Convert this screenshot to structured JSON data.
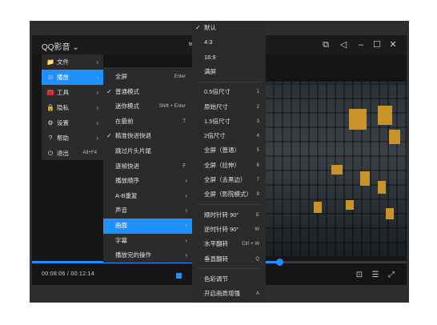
{
  "app": {
    "title": "QQ影音",
    "title_arrow": "⌄",
    "tab_fragment": "te"
  },
  "titlebar_icons": [
    "screenshot-icon",
    "share-icon",
    "minimize-icon",
    "maximize-icon",
    "close-icon"
  ],
  "player": {
    "time": "00:08:06 / 00:12:14",
    "progress": 0.66,
    "bottom_icons": [
      "screenshot-icon",
      "equalizer-icon",
      "fullscreen-icon"
    ]
  },
  "main_menu": {
    "items": [
      {
        "icon": "📁",
        "label": "文件",
        "arrow": "›",
        "shortcut": ""
      },
      {
        "icon": "⊙",
        "label": "播放",
        "arrow": "›",
        "shortcut": "",
        "active": true
      },
      {
        "icon": "🧰",
        "label": "工具",
        "arrow": "›",
        "shortcut": ""
      },
      {
        "icon": "🔒",
        "label": "隐私",
        "arrow": "›",
        "shortcut": ""
      },
      {
        "icon": "⚙",
        "label": "设置",
        "arrow": "›",
        "shortcut": ""
      },
      {
        "icon": "?",
        "label": "帮助",
        "arrow": "›",
        "shortcut": ""
      },
      {
        "icon": "⏻",
        "label": "退出",
        "arrow": "",
        "shortcut": "Alt+F4"
      }
    ]
  },
  "play_menu": {
    "items": [
      {
        "label": "全屏",
        "shortcut": "Enter",
        "arrow": "",
        "check": ""
      },
      {
        "label": "普通模式",
        "shortcut": "",
        "arrow": "",
        "check": "✓"
      },
      {
        "label": "迷你模式",
        "shortcut": "Shift + Enter",
        "arrow": "",
        "check": ""
      },
      {
        "label": "在最前",
        "shortcut": "T",
        "arrow": "",
        "check": ""
      },
      {
        "label": "精准快进快退",
        "shortcut": "",
        "arrow": "",
        "check": "✓"
      },
      {
        "label": "跳过片头片尾",
        "shortcut": "",
        "arrow": "",
        "check": ""
      },
      {
        "label": "逐帧快进",
        "shortcut": "F",
        "arrow": "",
        "check": ""
      },
      {
        "label": "播放顺序",
        "shortcut": "",
        "arrow": "›",
        "check": ""
      },
      {
        "label": "A-B重复",
        "shortcut": "",
        "arrow": "›",
        "check": ""
      },
      {
        "label": "声音",
        "shortcut": "",
        "arrow": "›",
        "check": ""
      },
      {
        "label": "画面",
        "shortcut": "",
        "arrow": "›",
        "check": "",
        "active": true
      },
      {
        "label": "字幕",
        "shortcut": "",
        "arrow": "›",
        "check": ""
      },
      {
        "label": "播放完的操作",
        "shortcut": "",
        "arrow": "›",
        "check": ""
      }
    ]
  },
  "picture_menu": {
    "items": [
      {
        "label": "默认",
        "shortcut": "",
        "check": "✓"
      },
      {
        "label": "4:3",
        "shortcut": "",
        "check": ""
      },
      {
        "label": "16:9",
        "shortcut": "",
        "check": ""
      },
      {
        "label": "满屏",
        "shortcut": "",
        "check": ""
      },
      {
        "label": "0.5倍尺寸",
        "shortcut": "1",
        "check": ""
      },
      {
        "label": "原始尺寸",
        "shortcut": "2",
        "check": ""
      },
      {
        "label": "1.5倍尺寸",
        "shortcut": "3",
        "check": ""
      },
      {
        "label": "2倍尺寸",
        "shortcut": "4",
        "check": ""
      },
      {
        "label": "全屏（普通）",
        "shortcut": "5",
        "check": ""
      },
      {
        "label": "全屏（拉伸）",
        "shortcut": "6",
        "check": ""
      },
      {
        "label": "全屏（去黑边）",
        "shortcut": "7",
        "check": ""
      },
      {
        "label": "全屏（影院模式）",
        "shortcut": "8",
        "check": ""
      },
      {
        "label": "顺时针转 90°",
        "shortcut": "E",
        "check": ""
      },
      {
        "label": "逆时针转 90°",
        "shortcut": "W",
        "check": ""
      },
      {
        "label": "水平翻转",
        "shortcut": "Ctrl + W",
        "check": ""
      },
      {
        "label": "垂直翻转",
        "shortcut": "Q",
        "check": ""
      },
      {
        "label": "色彩调节",
        "shortcut": "",
        "check": ""
      },
      {
        "label": "开启画质增强",
        "shortcut": "A",
        "check": ""
      }
    ]
  },
  "colors": {
    "accent": "#1e90ff",
    "menu_bg": "#2b2b2b",
    "window_bg": "#151515"
  }
}
